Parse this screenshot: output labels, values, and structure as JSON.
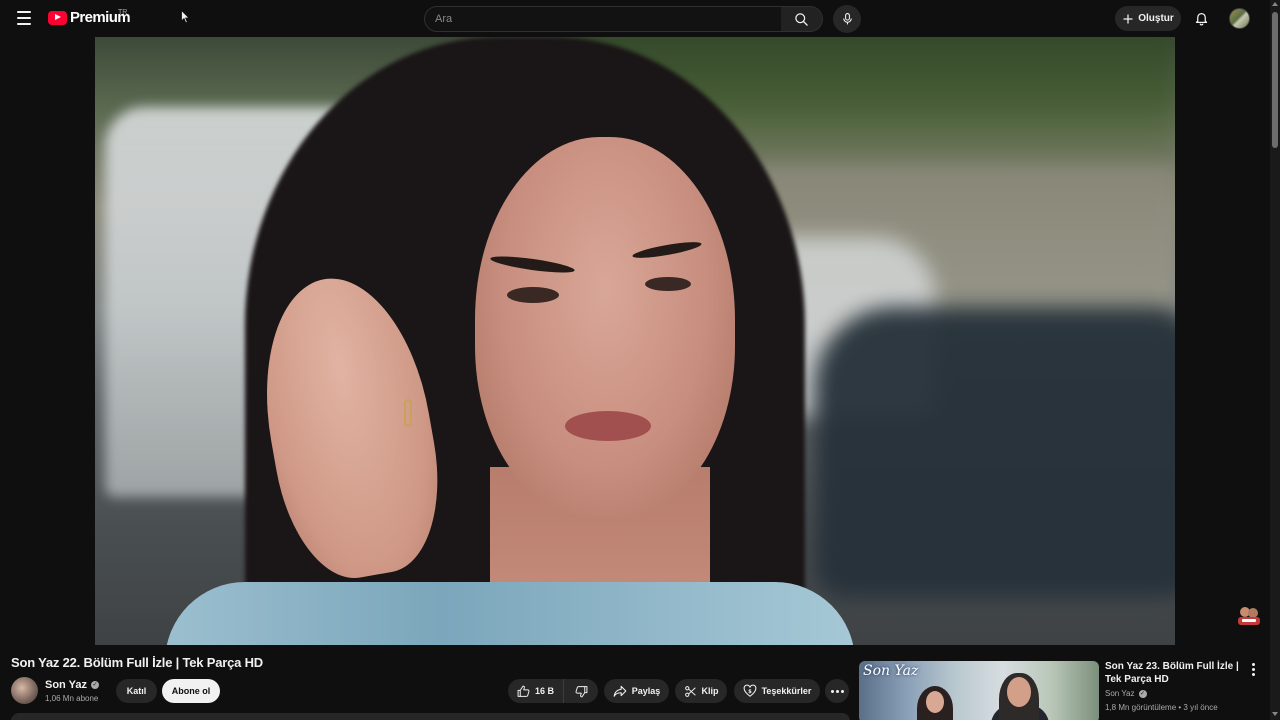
{
  "header": {
    "logo_text": "Premium",
    "logo_region": "TR",
    "search_placeholder": "Ara",
    "create_label": "Oluştur"
  },
  "video": {
    "title": "Son Yaz 22. Bölüm Full İzle | Tek Parça HD",
    "channel_name": "Son Yaz",
    "subscribers": "1,06 Mn abone",
    "join_label": "Katıl",
    "subscribe_label": "Abone ol",
    "likes": "16 B",
    "share_label": "Paylaş",
    "clip_label": "Klip",
    "thanks_label": "Teşekkürler"
  },
  "recommendation": {
    "thumb_text": "Son Yaz",
    "title": "Son Yaz 23. Bölüm Full İzle | Tek Parça HD",
    "channel": "Son Yaz",
    "meta": "1,8 Mn görüntüleme • 3 yıl önce"
  },
  "colors": {
    "background": "#0f0f0f",
    "brand_red": "#ff0033",
    "button_bg": "#272727",
    "subscribe_bg": "#f1f1f1"
  },
  "icons": [
    "menu-icon",
    "youtube-logo-icon",
    "search-icon",
    "mic-icon",
    "plus-icon",
    "bell-icon",
    "like-icon",
    "dislike-icon",
    "share-icon",
    "scissors-icon",
    "thanks-icon",
    "more-icon",
    "verified-icon"
  ]
}
